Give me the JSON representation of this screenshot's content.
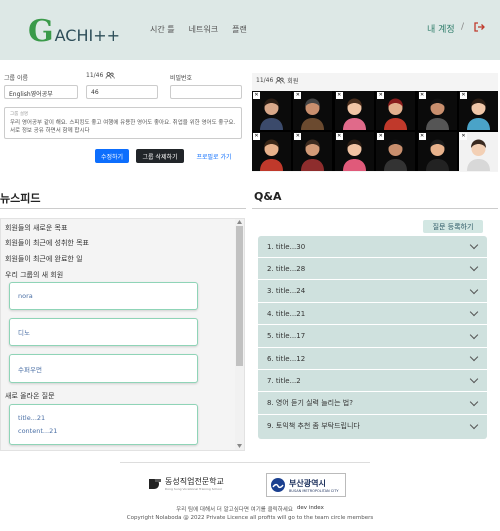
{
  "header": {
    "logo_g": "G",
    "logo_rest": "ACHI++",
    "nav": [
      "시간 틀",
      "네트워크",
      "플랜"
    ],
    "my_account": "내 계정",
    "separator": "/"
  },
  "form": {
    "group_name_label": "그룹 이름",
    "group_name_value": "English영어공부",
    "member_count_label": "11/46",
    "member_count_value": "46",
    "password_label": "비밀번호",
    "password_value": "",
    "description_label": "그룹 설명",
    "description": "우리 영어공부 같이 해요. 스피킹도 좋고 여행에 유용한 영어도 좋아요. 취업을 위한 영어도 좋구요. 서로 정보 공유 하면서 함께 합시다",
    "buttons": {
      "edit": "수정하기",
      "delete": "그룹 삭제하기",
      "profile": "프로필로 가기"
    }
  },
  "members": {
    "count": "11/46",
    "label": "회원",
    "grid_count": 12
  },
  "newsfeed": {
    "title": "뉴스피드",
    "lines": [
      "회원들의 새로운 목표",
      "회원들이 최근에 성취한 목표",
      "회원들이 최근에 완료한 일",
      "우리 그룹의 새 회원"
    ],
    "new_members": [
      "nora",
      "디노",
      "수퍼우먼"
    ],
    "new_questions_label": "새로 올라온 질문",
    "question_card": {
      "title": "title...21",
      "content": "content...21"
    }
  },
  "qa": {
    "title": "Q&A",
    "register_button": "질문 등록하기",
    "items": [
      "1. title...30",
      "2. title...28",
      "3. title...24",
      "4. title...21",
      "5. title...17",
      "6. title...12",
      "7. title...2",
      "8. 영어 듣기 실력 늘리는 법?",
      "9. 토익책 추천 좀 부탁드립니다"
    ]
  },
  "footer": {
    "logo1": "동성직업전문학교",
    "logo1_sub": "Dong Sung Vocational Training School",
    "logo2": "부산광역시",
    "logo2_sub": "BUSAN METROPOLITAN CITY",
    "line1": "우리 팀에 대해서 더 알고싶다면 여기를 클릭하세요",
    "line1_link": "dev index",
    "copyright": "Copyright Nolaboda @ 2022 Private Licence all profits will go to the team circle members"
  },
  "colors": {
    "accent": "#2e7d6a",
    "header_bg": "#dde8e6",
    "qa_bg": "#cfe1de",
    "primary": "#0d6efd"
  }
}
